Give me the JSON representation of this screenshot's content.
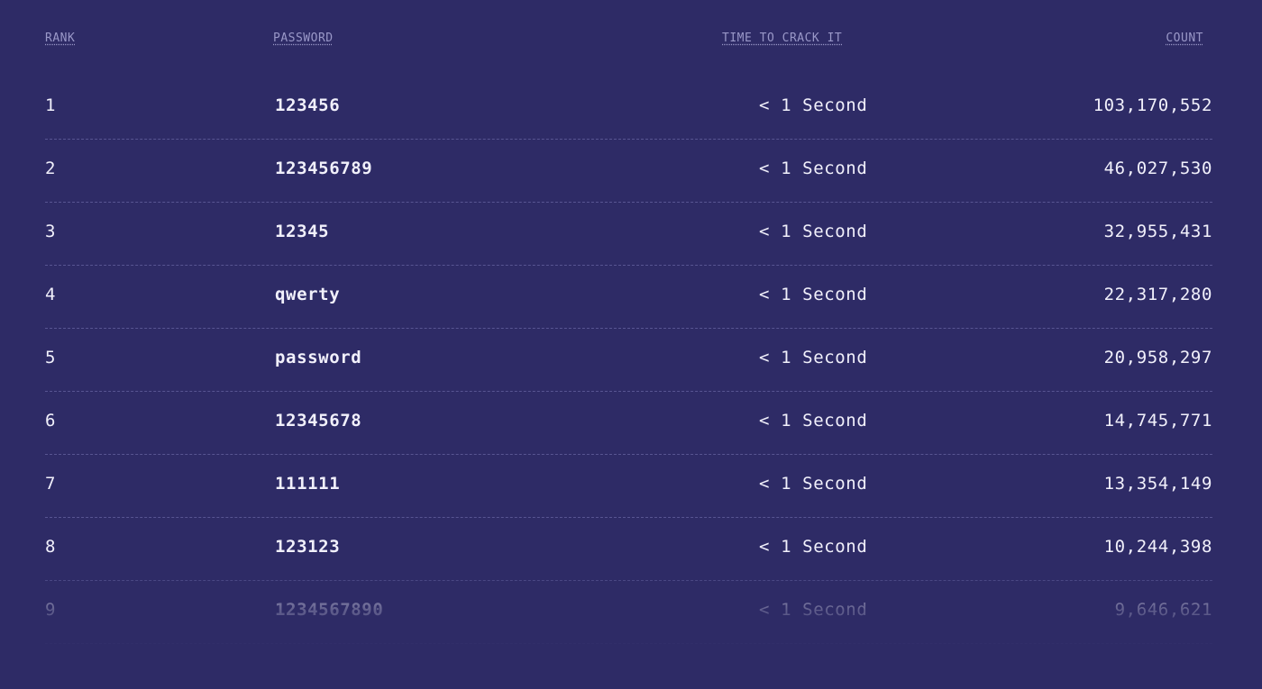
{
  "headers": {
    "rank": "RANK",
    "password": "PASSWORD",
    "time": "TIME TO CRACK IT",
    "count": "COUNT"
  },
  "rows": [
    {
      "rank": "1",
      "password": "123456",
      "time": "< 1 Second",
      "count": "103,170,552"
    },
    {
      "rank": "2",
      "password": "123456789",
      "time": "< 1 Second",
      "count": "46,027,530"
    },
    {
      "rank": "3",
      "password": "12345",
      "time": "< 1 Second",
      "count": "32,955,431"
    },
    {
      "rank": "4",
      "password": "qwerty",
      "time": "< 1 Second",
      "count": "22,317,280"
    },
    {
      "rank": "5",
      "password": "password",
      "time": "< 1 Second",
      "count": "20,958,297"
    },
    {
      "rank": "6",
      "password": "12345678",
      "time": "< 1 Second",
      "count": "14,745,771"
    },
    {
      "rank": "7",
      "password": "111111",
      "time": "< 1 Second",
      "count": "13,354,149"
    },
    {
      "rank": "8",
      "password": "123123",
      "time": "< 1 Second",
      "count": "10,244,398"
    },
    {
      "rank": "9",
      "password": "1234567890",
      "time": "< 1 Second",
      "count": "9,646,621"
    }
  ],
  "colors": {
    "background": "#2e2b66",
    "text": "#f1f0fb",
    "header": "#9a98c8"
  }
}
